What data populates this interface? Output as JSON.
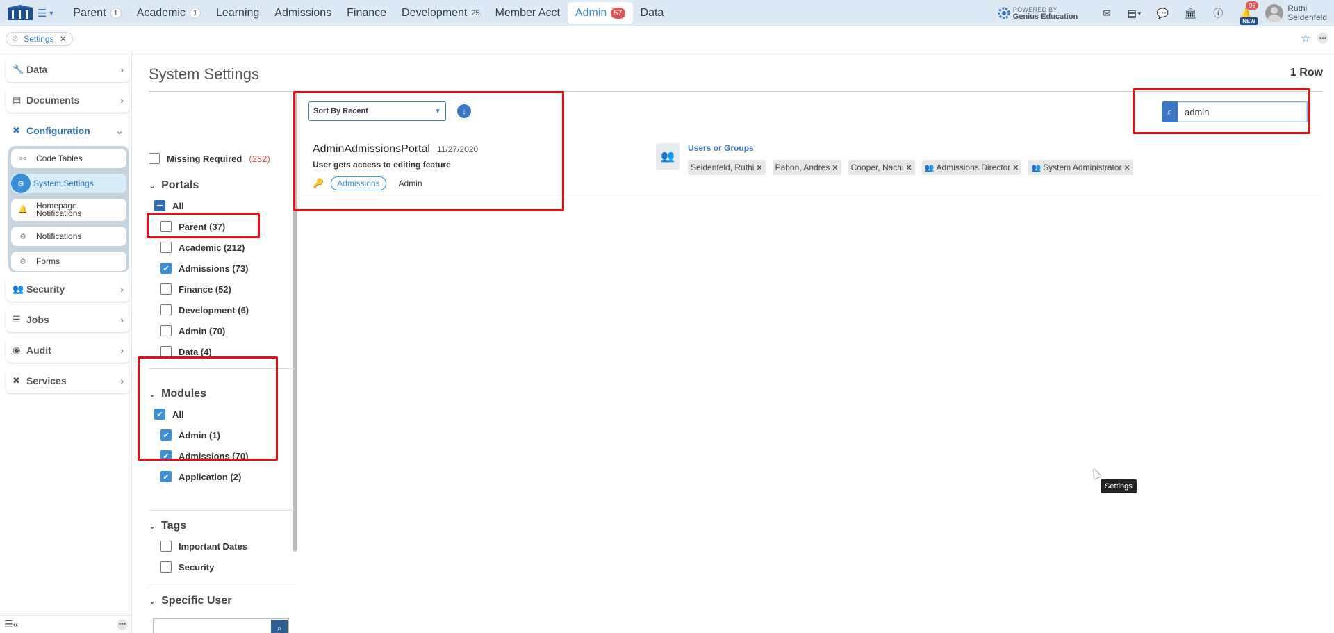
{
  "topnav": {
    "tabs": [
      {
        "label": "Parent",
        "badge": "1"
      },
      {
        "label": "Academic",
        "badge": "1"
      },
      {
        "label": "Learning",
        "badge": ""
      },
      {
        "label": "Admissions",
        "badge": ""
      },
      {
        "label": "Finance",
        "badge": ""
      },
      {
        "label": "Development",
        "badge": "25"
      },
      {
        "label": "Member Acct",
        "badge": ""
      },
      {
        "label": "Admin",
        "badge": "57"
      },
      {
        "label": "Data",
        "badge": ""
      }
    ],
    "powered_small": "POWERED BY",
    "powered_brand": "Genius Education",
    "notif_count": "96",
    "new_label": "NEW",
    "user_first": "Ruthi",
    "user_last": "Seidenfeld"
  },
  "breadcrumb": {
    "chip_label": "Settings"
  },
  "sidebar": {
    "items": [
      {
        "label": "Data"
      },
      {
        "label": "Documents"
      },
      {
        "label": "Configuration"
      },
      {
        "label": "Security"
      },
      {
        "label": "Jobs"
      },
      {
        "label": "Audit"
      },
      {
        "label": "Services"
      }
    ],
    "sub": [
      {
        "label": "Code Tables"
      },
      {
        "label": "System Settings"
      },
      {
        "label_line1": "Homepage",
        "label_line2": "Notifications"
      },
      {
        "label": "Notifications"
      },
      {
        "label": "Forms"
      }
    ]
  },
  "main": {
    "title": "System Settings",
    "row_count": "1 Row"
  },
  "filters": {
    "missing_label": "Missing Required",
    "missing_count": "(232)",
    "portals_head": "Portals",
    "portals": [
      "All",
      "Parent (37)",
      "Academic (212)",
      "Admissions (73)",
      "Finance (52)",
      "Development (6)",
      "Admin (70)",
      "Data (4)"
    ],
    "modules_head": "Modules",
    "modules": [
      "All",
      "Admin (1)",
      "Admissions (70)",
      "Application (2)"
    ],
    "tags_head": "Tags",
    "tags": [
      "Important Dates",
      "Security"
    ],
    "specific_head": "Specific User"
  },
  "results": {
    "sort_label": "Sort By Recent",
    "search_value": "admin",
    "record": {
      "name": "AdminAdmissionsPortal",
      "date": "11/27/2020",
      "desc": "User gets access to editing feature",
      "tag": "Admissions",
      "module": "Admin"
    },
    "users_title": "Users or Groups",
    "users": [
      "Seidenfeld, Ruthi",
      "Pabon, Andres",
      "Cooper, Nachi"
    ],
    "groups": [
      "Admissions Director",
      "System Administrator"
    ]
  },
  "tooltip": "Settings",
  "colors": {
    "accent": "#3a8fd6",
    "highlight": "#e3101a",
    "nav_bg": "#dde9f5"
  }
}
